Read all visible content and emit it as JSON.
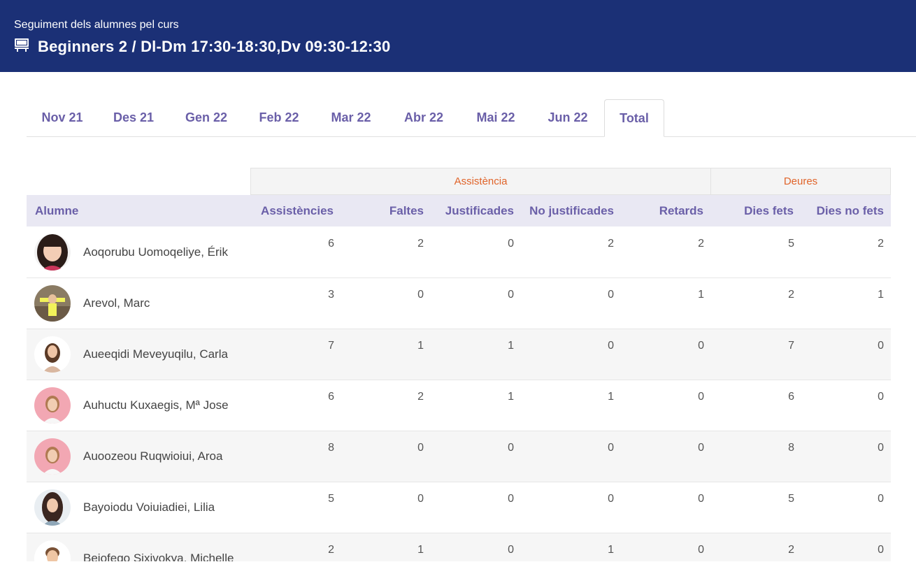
{
  "header": {
    "subtitle": "Seguiment dels alumnes pel curs",
    "title": "Beginners 2 / Dl-Dm 17:30-18:30,Dv 09:30-12:30",
    "icon": "presentation-board-icon"
  },
  "tabs": [
    {
      "label": "Nov 21",
      "active": false
    },
    {
      "label": "Des 21",
      "active": false
    },
    {
      "label": "Gen 22",
      "active": false
    },
    {
      "label": "Feb 22",
      "active": false
    },
    {
      "label": "Mar 22",
      "active": false
    },
    {
      "label": "Abr 22",
      "active": false
    },
    {
      "label": "Mai 22",
      "active": false
    },
    {
      "label": "Jun 22",
      "active": false
    },
    {
      "label": "Total",
      "active": true
    }
  ],
  "table": {
    "groups": {
      "attendance": "Assistència",
      "homework": "Deures"
    },
    "columns": {
      "student": "Alumne",
      "attendances": "Assistències",
      "absences": "Faltes",
      "justified": "Justificades",
      "unjustified": "No justificades",
      "late": "Retards",
      "done": "Dies fets",
      "not_done": "Dies no fets"
    },
    "rows": [
      {
        "name": "Aoqorubu Uomoqeliye, Érik",
        "values": [
          "6",
          "2",
          "0",
          "2",
          "2",
          "5",
          "2"
        ]
      },
      {
        "name": "Arevol, Marc",
        "values": [
          "3",
          "0",
          "0",
          "0",
          "1",
          "2",
          "1"
        ]
      },
      {
        "name": "Aueeqidi Meveyuqilu, Carla",
        "values": [
          "7",
          "1",
          "1",
          "0",
          "0",
          "7",
          "0"
        ]
      },
      {
        "name": "Auhuctu Kuxaegis, Mª Jose",
        "values": [
          "6",
          "2",
          "1",
          "1",
          "0",
          "6",
          "0"
        ]
      },
      {
        "name": "Auoozeou Ruqwioiui, Aroa",
        "values": [
          "8",
          "0",
          "0",
          "0",
          "0",
          "8",
          "0"
        ]
      },
      {
        "name": "Bayoiodu Voiuiadiei, Lilia",
        "values": [
          "5",
          "0",
          "0",
          "0",
          "0",
          "5",
          "0"
        ]
      },
      {
        "name": "Bejofego Sixivokya, Michelle",
        "values": [
          "2",
          "1",
          "0",
          "1",
          "0",
          "2",
          "0"
        ]
      }
    ]
  },
  "colors": {
    "header_bg": "#1b3076",
    "tab_text": "#6a5fa8",
    "group_text": "#e0642a",
    "column_head_bg": "#e9e8f3"
  }
}
